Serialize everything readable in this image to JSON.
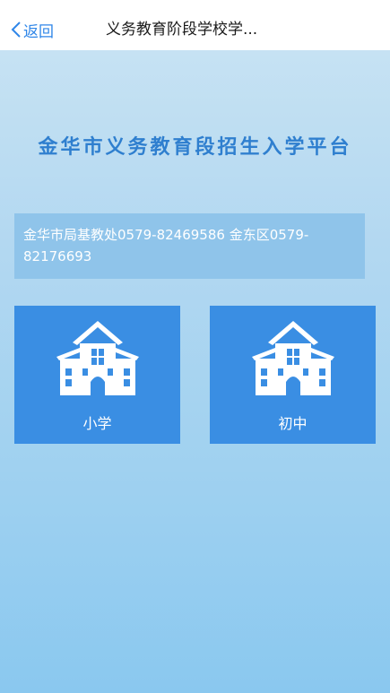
{
  "nav": {
    "back_label": "返回",
    "title": "义务教育阶段学校学..."
  },
  "main": {
    "platform_title": "金华市义务教育段招生入学平台",
    "notice": "金华市局基教处0579-82469586 金东区0579-82176693",
    "tiles": [
      {
        "label": "小学",
        "icon": "school-building-icon"
      },
      {
        "label": "初中",
        "icon": "school-building-icon"
      }
    ]
  },
  "colors": {
    "accent": "#2f86e8",
    "title_blue": "#2f7fcf",
    "tile_blue": "#3a8ee3",
    "notice_bg": "#8fc4ea"
  }
}
